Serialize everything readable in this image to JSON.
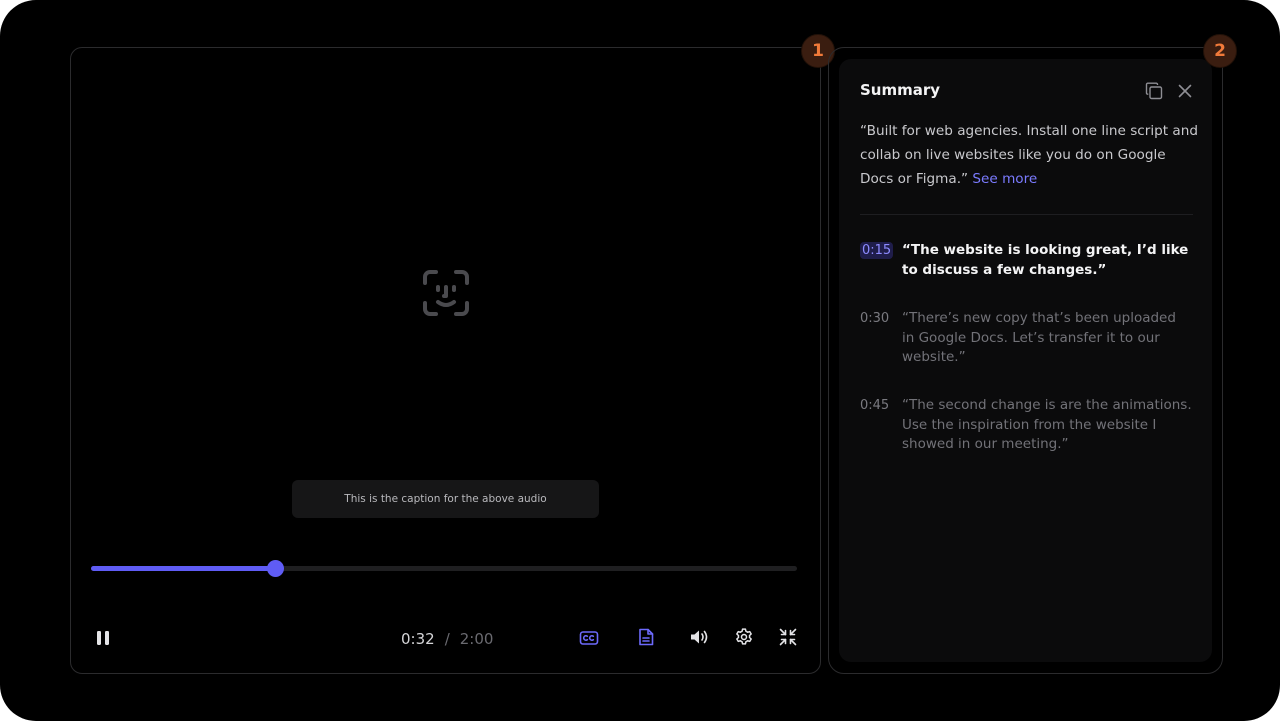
{
  "player": {
    "caption": "This is the caption for the above audio",
    "current_time": "0:32",
    "separator": "/",
    "total_time": "2:00",
    "progress": 0.26,
    "accent_color": "#5f5cf5",
    "icons": {
      "center": "face-scan-icon",
      "play_pause": "pause-icon",
      "captions": "closed-captions-icon",
      "transcript": "document-icon",
      "volume": "volume-icon",
      "settings": "gear-icon",
      "fullscreen": "exit-fullscreen-icon"
    }
  },
  "badges": {
    "player": "1",
    "summary": "2",
    "color": "#f07a3a"
  },
  "summary": {
    "title": "Summary",
    "description": "“Built for web agencies. Install one line script and collab on live websites like you do on Google Docs or Figma.”",
    "see_more": "See more",
    "icons": {
      "copy": "copy-icon",
      "close": "close-icon"
    },
    "transcript": [
      {
        "time": "0:15",
        "text": "“The website is looking great, I’d like to discuss a few changes.”",
        "active": true
      },
      {
        "time": "0:30",
        "text": "“There’s new copy that’s been uploaded in Google Docs. Let’s transfer it to our website.”",
        "active": false
      },
      {
        "time": "0:45",
        "text": "“The second change is are the animations. Use the inspiration from the website I showed in our meeting.”",
        "active": false
      }
    ]
  }
}
